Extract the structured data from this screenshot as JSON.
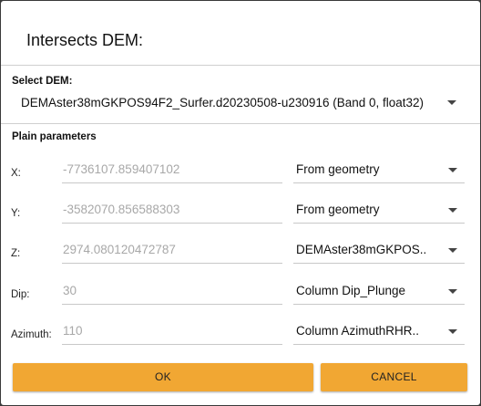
{
  "dialog": {
    "title": "Intersects DEM:",
    "dem_section_label": "Select DEM:",
    "dem_selected": "DEMAster38mGKPOS94F2_Surfer.d20230508-u230916 (Band 0, float32)",
    "plain_section_label": "Plain parameters",
    "rows": [
      {
        "label": "X:",
        "value": "-7736107.859407102",
        "source": "From geometry"
      },
      {
        "label": "Y:",
        "value": "-3582070.856588303",
        "source": "From geometry"
      },
      {
        "label": "Z:",
        "value": "2974.080120472787",
        "source": "DEMAster38mGKPOS.."
      },
      {
        "label": "Dip:",
        "value": "30",
        "source": "Column Dip_Plunge"
      },
      {
        "label": "Azimuth:",
        "value": "110",
        "source": "Column AzimuthRHR.."
      }
    ],
    "ok_label": "OK",
    "cancel_label": "CANCEL"
  },
  "colors": {
    "button": "#f1a733",
    "backdrop": "#3a3a3a"
  },
  "icons": [
    "dropdown-caret-icon"
  ]
}
